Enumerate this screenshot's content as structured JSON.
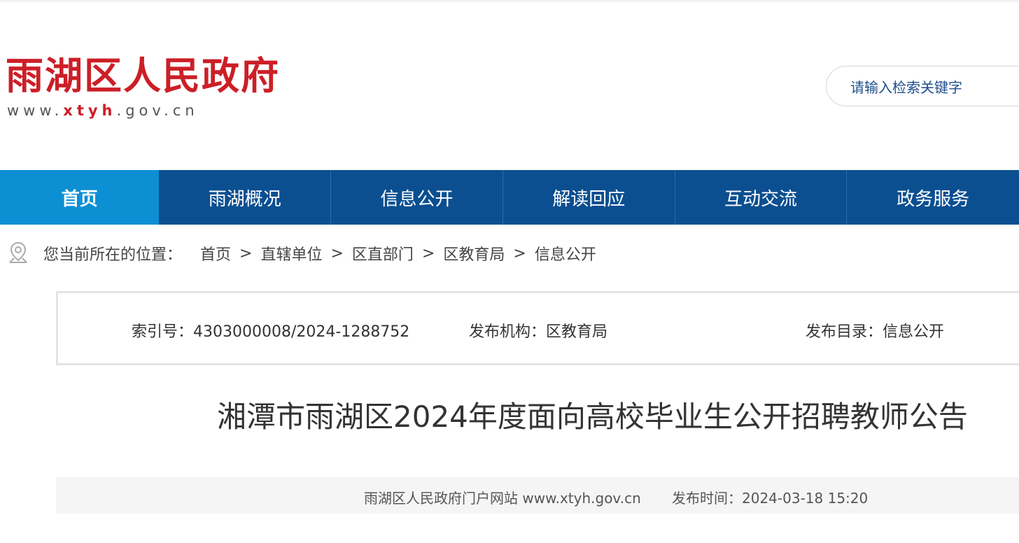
{
  "header": {
    "site_title": "雨湖区人民政府",
    "site_url_prefix": "www.",
    "site_url_highlight": "xtyh",
    "site_url_suffix": ".gov.cn",
    "search_placeholder": "请输入检索关键字"
  },
  "nav": {
    "items": [
      {
        "label": "首页"
      },
      {
        "label": "雨湖概况"
      },
      {
        "label": "信息公开"
      },
      {
        "label": "解读回应"
      },
      {
        "label": "互动交流"
      },
      {
        "label": "政务服务"
      }
    ]
  },
  "breadcrumb": {
    "label": "您当前所在的位置：",
    "items": [
      "首页",
      "直辖单位",
      "区直部门",
      "区教育局",
      "信息公开"
    ],
    "separator": ">"
  },
  "meta": {
    "index_label": "索引号：",
    "index_value": "4303000008/2024-1288752",
    "org_label": "发布机构：",
    "org_value": "区教育局",
    "catalog_label": "发布目录：",
    "catalog_value": "信息公开"
  },
  "article": {
    "title": "湘潭市雨湖区2024年度面向高校毕业生公开招聘教师公告",
    "source": "雨湖区人民政府门户网站 www.xtyh.gov.cn",
    "publish_label": "发布时间：",
    "publish_time": "2024-03-18 15:20"
  },
  "colors": {
    "brand_red": "#cc1f27",
    "nav_blue": "#0b4f91",
    "nav_active": "#0d8fd3"
  }
}
